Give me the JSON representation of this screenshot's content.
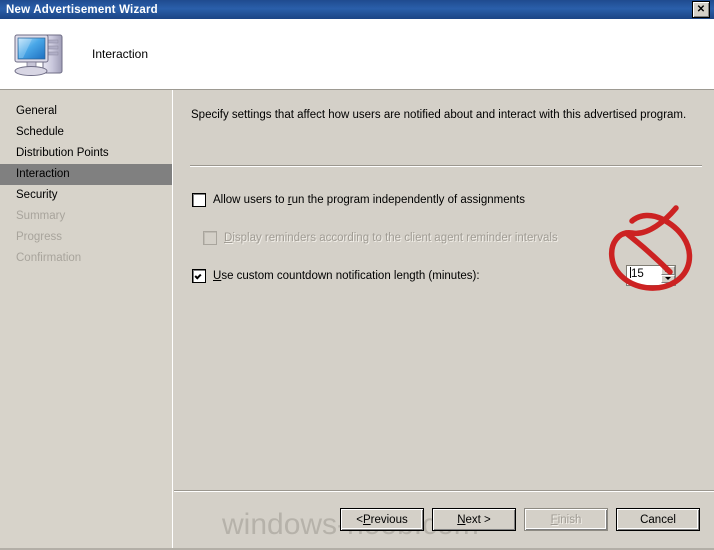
{
  "window": {
    "title": "New Advertisement Wizard",
    "close_icon": "close-icon",
    "close_label": "✕"
  },
  "banner": {
    "icon": "computer-icon",
    "title": "Interaction"
  },
  "sidebar": {
    "items": [
      {
        "label": "General",
        "state": "normal"
      },
      {
        "label": "Schedule",
        "state": "normal"
      },
      {
        "label": "Distribution Points",
        "state": "normal"
      },
      {
        "label": "Interaction",
        "state": "selected"
      },
      {
        "label": "Security",
        "state": "normal"
      },
      {
        "label": "Summary",
        "state": "disabled"
      },
      {
        "label": "Progress",
        "state": "disabled"
      },
      {
        "label": "Confirmation",
        "state": "disabled"
      }
    ]
  },
  "main": {
    "description": "Specify settings that affect how users are notified about and interact with this advertised program.",
    "options": [
      {
        "label_pre": "Allow users to ",
        "label_accel": "r",
        "label_post": "un the program independently of assignments",
        "checked": false,
        "disabled": false
      },
      {
        "label_pre": "",
        "label_accel": "D",
        "label_post": "isplay reminders according to the client agent reminder intervals",
        "checked": false,
        "disabled": true
      },
      {
        "label_pre": "",
        "label_accel": "U",
        "label_post": "se custom countdown notification length (minutes):",
        "checked": true,
        "disabled": false
      }
    ],
    "spinner": {
      "value": "15",
      "up_icon": "spinner-up-arrow-icon",
      "down_icon": "spinner-down-arrow-icon"
    }
  },
  "annotation": {
    "shape": "red-circle-highlight",
    "color": "#cc2222"
  },
  "footer": {
    "buttons": [
      {
        "pre": "< ",
        "accel": "P",
        "post": "revious",
        "state": "normal"
      },
      {
        "pre": "",
        "accel": "N",
        "post": "ext >",
        "state": "default"
      },
      {
        "pre": "",
        "accel": "F",
        "post": "inish",
        "state": "disabled"
      },
      {
        "pre": "",
        "accel": "",
        "post": "Cancel",
        "state": "normal"
      }
    ]
  },
  "watermark": {
    "text": "windows-noob.com"
  }
}
